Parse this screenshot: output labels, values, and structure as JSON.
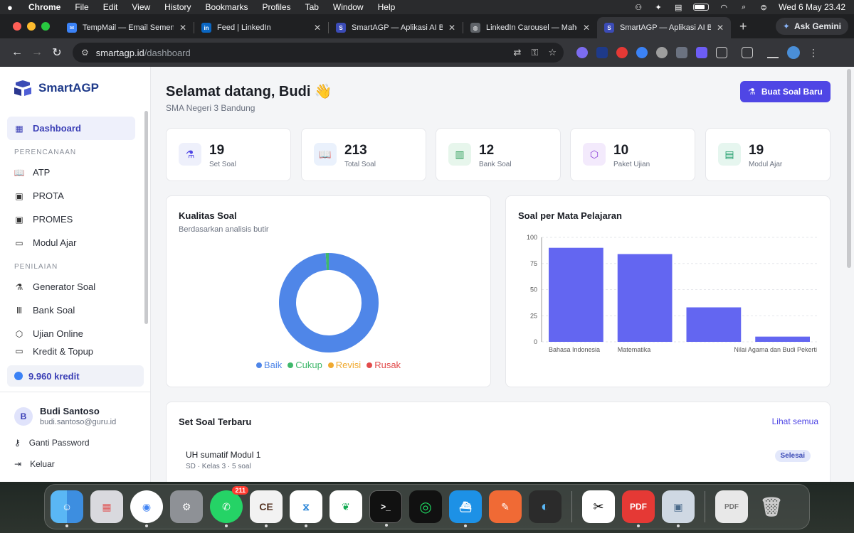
{
  "menubar": {
    "app": "Chrome",
    "items": [
      "File",
      "Edit",
      "View",
      "History",
      "Bookmarks",
      "Profiles",
      "Tab",
      "Window",
      "Help"
    ],
    "datetime": "Wed 6 May  23.42"
  },
  "tabs": [
    {
      "label": "TempMail — Email Sementara",
      "favicon_color": "#3b82f6"
    },
    {
      "label": "Feed | LinkedIn",
      "favicon_color": "#0a66c2"
    },
    {
      "label": "SmartAGP — Aplikasi AI Buat",
      "favicon_color": "#3b4bb6"
    },
    {
      "label": "LinkedIn Carousel — Mahen",
      "favicon_color": "#5f6368"
    },
    {
      "label": "SmartAGP — Aplikasi AI Buat",
      "favicon_color": "#3b4bb6"
    }
  ],
  "ask_gemini": "Ask Gemini",
  "address": {
    "host": "smartagp.id",
    "path": "/dashboard"
  },
  "app": {
    "brand": "SmartAGP",
    "nav_dashboard": "Dashboard",
    "section_perencanaan": "PERENCANAAN",
    "nav_atp": "ATP",
    "nav_prota": "PROTA",
    "nav_promes": "PROMES",
    "nav_modul": "Modul Ajar",
    "section_penilaian": "PENILAIAN",
    "nav_generator": "Generator Soal",
    "nav_bank": "Bank Soal",
    "nav_ujian": "Ujian Online",
    "nav_kredit": "Kredit & Topup",
    "credit": "9.960 kredit",
    "user_initial": "B",
    "user_name": "Budi Santoso",
    "user_email": "budi.santoso@guru.id",
    "change_password": "Ganti Password",
    "logout": "Keluar"
  },
  "header": {
    "greeting": "Selamat datang, Budi 👋",
    "school": "SMA Negeri 3 Bandung",
    "create_button": "Buat Soal Baru"
  },
  "stats": [
    {
      "value": "19",
      "label": "Set Soal",
      "color": "#4f46e5",
      "bg": "#eef0fb"
    },
    {
      "value": "213",
      "label": "Total Soal",
      "color": "#3b6fd8",
      "bg": "#eaf1fc"
    },
    {
      "value": "12",
      "label": "Bank Soal",
      "color": "#2f9e5a",
      "bg": "#e7f6ec"
    },
    {
      "value": "10",
      "label": "Paket Ujian",
      "color": "#8b3fd8",
      "bg": "#f3eafc"
    },
    {
      "value": "19",
      "label": "Modul Ajar",
      "color": "#1f9d6b",
      "bg": "#e6f6ef"
    }
  ],
  "quality": {
    "title": "Kualitas Soal",
    "subtitle": "Berdasarkan analisis butir"
  },
  "subject_chart": {
    "title": "Soal per Mata Pelajaran"
  },
  "chart_data": [
    {
      "type": "pie",
      "categories": [
        "Baik",
        "Cukup",
        "Revisi",
        "Rusak"
      ],
      "values": [
        99,
        1,
        0,
        0
      ],
      "colors": [
        "#4f86e8",
        "#3fb86b",
        "#f0a92f",
        "#e24b4b"
      ],
      "legend": "bottom"
    },
    {
      "type": "bar",
      "categories": [
        "Bahasa Indonesia",
        "Matematika",
        "",
        "Nilai Agama dan Budi Pekerti"
      ],
      "values": [
        90,
        84,
        33,
        5
      ],
      "ylim": [
        0,
        100
      ],
      "yticks": [
        0,
        25,
        50,
        75,
        100
      ],
      "grid": true,
      "color": "#6366f1"
    }
  ],
  "recent": {
    "title": "Set Soal Terbaru",
    "see_all": "Lihat semua",
    "items": [
      {
        "title": "UH sumatif Modul 1",
        "meta": "SD · Kelas 3 · 5 soal",
        "status": "Selesai"
      }
    ]
  },
  "dock": {
    "whatsapp_badge": "211"
  }
}
